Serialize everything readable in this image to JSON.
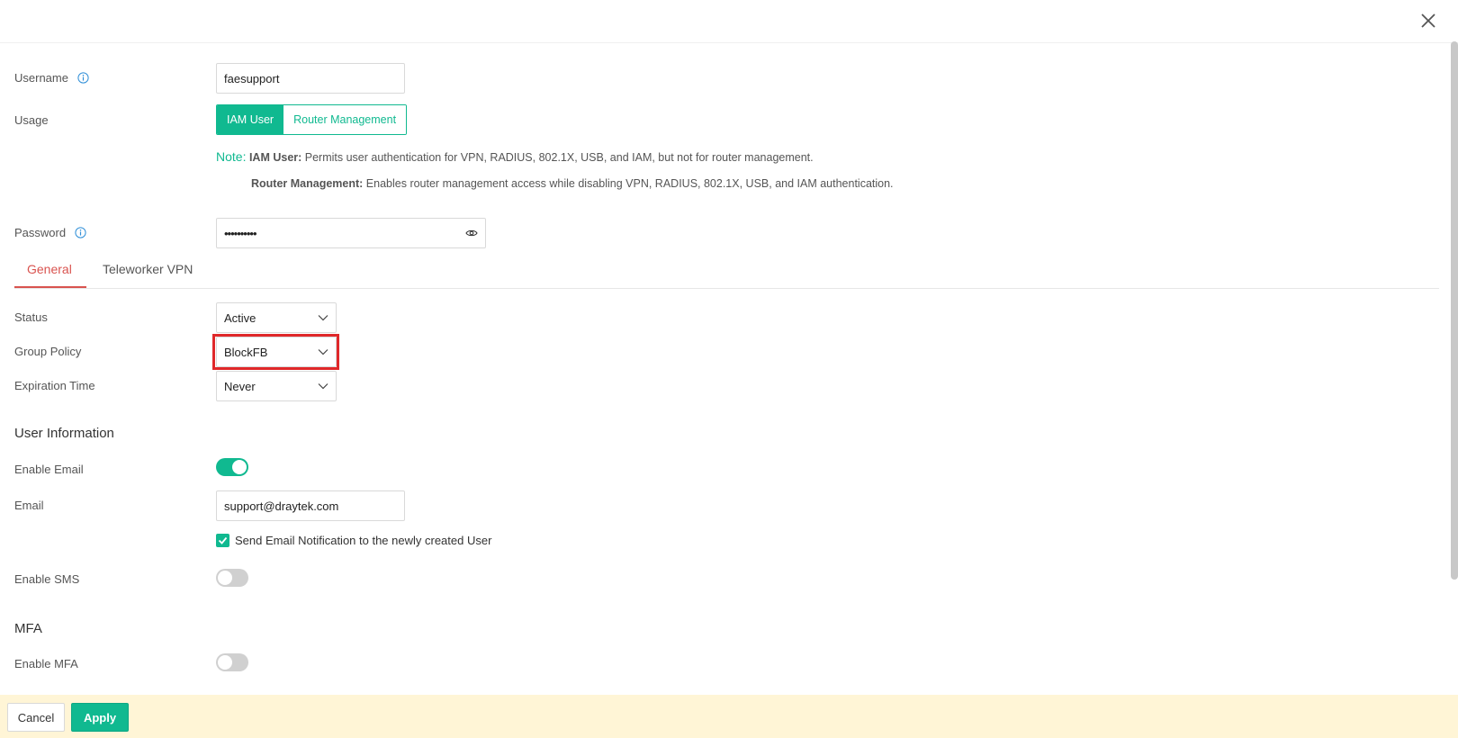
{
  "dialog": {
    "close_icon": "close-icon"
  },
  "form": {
    "username": {
      "label": "Username",
      "value": "faesupport"
    },
    "usage": {
      "label": "Usage",
      "options": [
        "IAM User",
        "Router Management"
      ],
      "selected": "IAM User"
    },
    "note": {
      "prefix": "Note:",
      "line1_bold": "IAM User:",
      "line1_text": " Permits user authentication for VPN, RADIUS, 802.1X, USB, and IAM, but not for router management.",
      "line2_bold": "Router Management:",
      "line2_text": " Enables router management access while disabling VPN, RADIUS, 802.1X, USB, and IAM authentication."
    },
    "password": {
      "label": "Password",
      "value": "••••••••••"
    }
  },
  "tabs": [
    {
      "label": "General",
      "active": true
    },
    {
      "label": "Teleworker VPN",
      "active": false
    }
  ],
  "general": {
    "status": {
      "label": "Status",
      "value": "Active"
    },
    "group_policy": {
      "label": "Group Policy",
      "value": "BlockFB"
    },
    "expiration": {
      "label": "Expiration Time",
      "value": "Never"
    }
  },
  "user_info": {
    "title": "User Information",
    "enable_email": {
      "label": "Enable Email",
      "on": true
    },
    "email": {
      "label": "Email",
      "value": "support@draytek.com"
    },
    "notify": {
      "label": "Send Email Notification to the newly created User",
      "checked": true
    },
    "enable_sms": {
      "label": "Enable SMS",
      "on": false
    }
  },
  "mfa": {
    "title": "MFA",
    "enable_mfa": {
      "label": "Enable MFA",
      "on": false
    }
  },
  "footer": {
    "cancel_label": "Cancel",
    "apply_label": "Apply"
  },
  "colors": {
    "accent": "#10b990",
    "tab_active": "#d9534f",
    "highlight": "#e0282a",
    "footer_bg": "#fff5d6"
  }
}
